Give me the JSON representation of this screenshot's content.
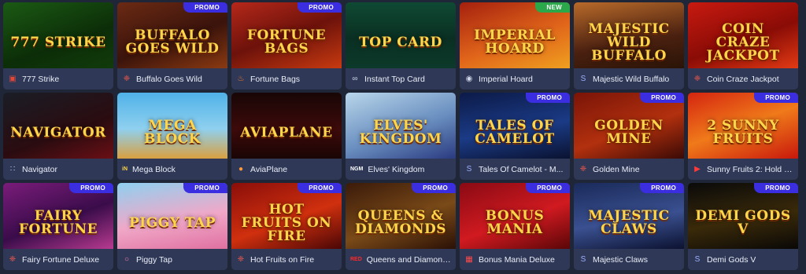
{
  "badges": {
    "promo": "PROMO",
    "new": "NEW"
  },
  "games": [
    {
      "name": "777 Strike",
      "art": "777 Strike",
      "provider_icon": "square-icon",
      "badge": "",
      "bg": "linear-gradient(160deg,#1b5a14,#0c2d08 60%,#113b0b)"
    },
    {
      "name": "Buffalo Goes Wild",
      "art": "Buffalo Goes Wild",
      "provider_icon": "dots-icon",
      "badge": "promo",
      "bg": "linear-gradient(160deg,#6b2a14,#3a130b 55%,#8b3a12)"
    },
    {
      "name": "Fortune Bags",
      "art": "Fortune Bags",
      "provider_icon": "flame-icon",
      "badge": "promo",
      "bg": "linear-gradient(160deg,#b5281a,#6d120b 50%,#c83a10)"
    },
    {
      "name": "Instant Top Card",
      "art": "Top Card",
      "provider_icon": "infinity-icon",
      "badge": "",
      "bg": "linear-gradient(180deg,#0f4a33,#0a2f22 55%,#0c3a2a)"
    },
    {
      "name": "Imperial Hoard",
      "art": "Imperial Hoard",
      "provider_icon": "gamepad-icon",
      "badge": "new",
      "bg": "linear-gradient(160deg,#a5200e,#e0641a 55%,#f0a020)"
    },
    {
      "name": "Majestic Wild Buffalo",
      "art": "Majestic Wild Buffalo",
      "provider_icon": "s-icon",
      "badge": "",
      "bg": "linear-gradient(170deg,#b86a2a,#4a2010 60%,#2a1407)"
    },
    {
      "name": "Coin Craze Jackpot",
      "art": "Coin Craze Jackpot",
      "provider_icon": "dots-icon",
      "badge": "",
      "bg": "linear-gradient(160deg,#c81a10,#8a0c06 55%,#e23a14)"
    },
    {
      "name": "Navigator",
      "art": "Navigator",
      "provider_icon": "grid-icon",
      "badge": "",
      "bg": "linear-gradient(160deg,#1a1d26,#2a0c10 60%,#6a0f15)"
    },
    {
      "name": "Mega Block",
      "art": "Mega Block",
      "provider_icon": "in-icon",
      "badge": "",
      "bg": "linear-gradient(180deg,#4fb2e8,#8fd0ef 55%,#d9a040)"
    },
    {
      "name": "AviaPlane",
      "art": "AviaPlane",
      "provider_icon": "circle-icon",
      "badge": "",
      "bg": "linear-gradient(180deg,#180606,#3d0a0a 55%,#1a0505)"
    },
    {
      "name": "Elves' Kingdom",
      "art": "Elves' Kingdom",
      "provider_icon": "ngm-icon",
      "badge": "",
      "bg": "linear-gradient(160deg,#b9d6ea,#6a8fc0 55%,#2a3a80)"
    },
    {
      "name": "Tales Of Camelot - M...",
      "art": "Tales of Camelot",
      "provider_icon": "s-icon",
      "badge": "promo",
      "bg": "linear-gradient(170deg,#0c1a48,#1b3b86 55%,#0a1230)"
    },
    {
      "name": "Golden Mine",
      "art": "Golden Mine",
      "provider_icon": "dots-icon",
      "badge": "promo",
      "bg": "linear-gradient(160deg,#7a1408,#b2300e 55%,#3b0a05)"
    },
    {
      "name": "Sunny Fruits 2: Hold a...",
      "art": "2 Sunny Fruits",
      "provider_icon": "play-icon",
      "badge": "promo",
      "bg": "linear-gradient(160deg,#d42510,#f07a1a 50%,#c8180c)"
    },
    {
      "name": "Fairy Fortune Deluxe",
      "art": "Fairy Fortune",
      "provider_icon": "dots-icon",
      "badge": "promo",
      "bg": "linear-gradient(160deg,#7a1c7a,#3a0c4a 55%,#b83a90)"
    },
    {
      "name": "Piggy Tap",
      "art": "Piggy Tap",
      "provider_icon": "ring-icon",
      "badge": "promo",
      "bg": "linear-gradient(170deg,#8fd0f0,#f0a8c8 55%,#e070a0)"
    },
    {
      "name": "Hot Fruits on Fire",
      "art": "Hot Fruits on Fire",
      "provider_icon": "dots-icon",
      "badge": "promo",
      "bg": "linear-gradient(160deg,#8a0e0a,#d0300e 55%,#4a0606)"
    },
    {
      "name": "Queens and Diamonds",
      "art": "Queens & Diamonds",
      "provider_icon": "red-icon",
      "badge": "promo",
      "bg": "linear-gradient(160deg,#3a1a0a,#7a4a18 55%,#2a1006)"
    },
    {
      "name": "Bonus Mania Deluxe",
      "art": "Bonus Mania",
      "provider_icon": "cube-icon",
      "badge": "promo",
      "bg": "linear-gradient(160deg,#8a0a14,#d01a20 55%,#5a0608)"
    },
    {
      "name": "Majestic Claws",
      "art": "Majestic Claws",
      "provider_icon": "s-icon",
      "badge": "promo",
      "bg": "linear-gradient(170deg,#1a2a5a,#3a5090 55%,#0c1230)"
    },
    {
      "name": "Demi Gods V",
      "art": "Demi Gods V",
      "provider_icon": "s-icon",
      "badge": "promo",
      "bg": "linear-gradient(170deg,#0a0a0a,#3a2a0a 55%,#0a0806)"
    }
  ]
}
